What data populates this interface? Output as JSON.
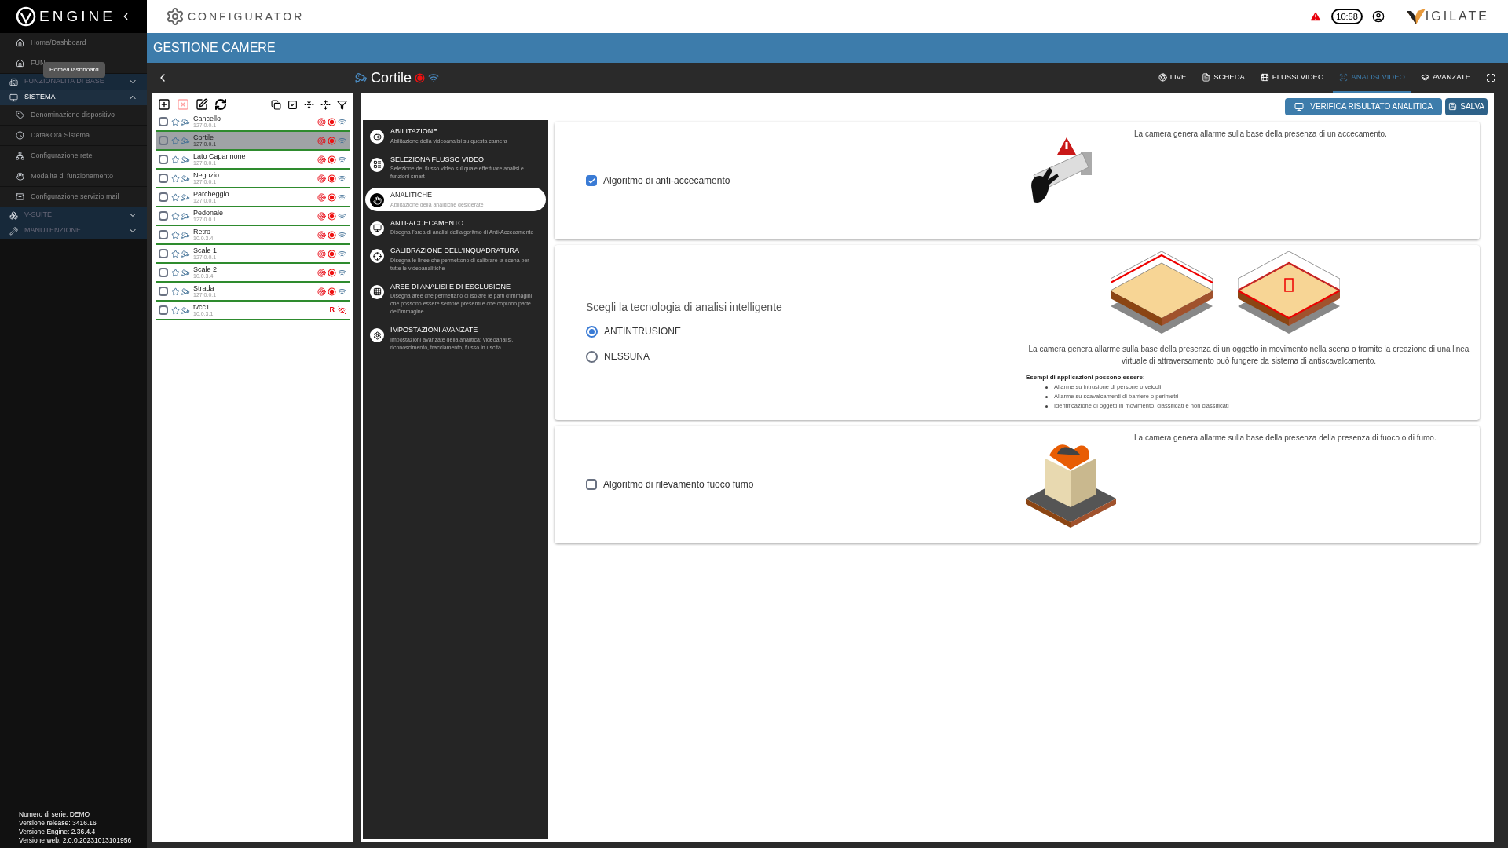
{
  "brand": {
    "name": "ENGINE",
    "app": "CONFIGURATOR",
    "vendor": "IGILATE"
  },
  "header": {
    "clock": "10:58",
    "alert": true
  },
  "sidebar": {
    "items": [
      {
        "kind": "item",
        "label": "Home/Dashboard"
      },
      {
        "kind": "item",
        "label": "FUN"
      },
      {
        "kind": "section",
        "label": "FUNZIONALITA DI BASE",
        "expanded": false
      },
      {
        "kind": "section",
        "label": "SISTEMA",
        "expanded": true,
        "children": [
          {
            "kind": "item",
            "label": "Denominazione dispositivo"
          },
          {
            "kind": "item",
            "label": "Data&Ora Sistema"
          },
          {
            "kind": "item",
            "label": "Configurazione rete"
          },
          {
            "kind": "item",
            "label": "Modalita di funzionamento"
          },
          {
            "kind": "item",
            "label": "Configurazione servizio mail"
          }
        ]
      },
      {
        "kind": "section",
        "label": "V-SUITE",
        "expanded": false
      },
      {
        "kind": "section",
        "label": "MANUTENZIONE",
        "expanded": false
      }
    ],
    "tooltip": "Home/Dashboard",
    "footer": [
      "Numero di serie: DEMO",
      "Versione release: 3416.16",
      "Versione Engine: 2.36.4.4",
      "Versione web: 2.0.0.20231013101956"
    ]
  },
  "page_title": "GESTIONE CAMERE",
  "camera": {
    "name": "Cortile",
    "online": true
  },
  "tabs": [
    {
      "label": "LIVE",
      "selected": false
    },
    {
      "label": "SCHEDA",
      "selected": false
    },
    {
      "label": "FLUSSI VIDEO",
      "selected": false
    },
    {
      "label": "ANALISI VIDEO",
      "selected": true
    },
    {
      "label": "AVANZATE",
      "selected": false
    }
  ],
  "cameras": [
    {
      "name": "Cancello",
      "ip": "127.0.0.1",
      "selected": false,
      "online": true
    },
    {
      "name": "Cortile",
      "ip": "127.0.0.1",
      "selected": true,
      "online": true
    },
    {
      "name": "Lato Capannone",
      "ip": "127.0.0.1",
      "selected": false,
      "online": true
    },
    {
      "name": "Negozio",
      "ip": "127.0.0.1",
      "selected": false,
      "online": true
    },
    {
      "name": "Parcheggio",
      "ip": "127.0.0.1",
      "selected": false,
      "online": true
    },
    {
      "name": "Pedonale",
      "ip": "127.0.0.1",
      "selected": false,
      "online": true
    },
    {
      "name": "Retro",
      "ip": "10.0.3.4",
      "selected": false,
      "online": true
    },
    {
      "name": "Scale 1",
      "ip": "127.0.0.1",
      "selected": false,
      "online": true
    },
    {
      "name": "Scale 2",
      "ip": "10.0.3.4",
      "selected": false,
      "online": true
    },
    {
      "name": "Strada",
      "ip": "127.0.0.1",
      "selected": false,
      "online": true
    },
    {
      "name": "tvcc1",
      "ip": "10.0.3.1",
      "selected": false,
      "online": false,
      "badge": "R"
    }
  ],
  "steps": [
    {
      "title": "ABILITAZIONE",
      "desc": "Abilitazione della videoanalisi su questa camera",
      "selected": false
    },
    {
      "title": "SELEZIONA FLUSSO VIDEO",
      "desc": "Selezione del flusso video sul quale effettuare analisi e funzioni smart",
      "selected": false
    },
    {
      "title": "ANALITICHE",
      "desc": "Abilitazione della analitiche desiderate",
      "selected": true
    },
    {
      "title": "ANTI-ACCECAMENTO",
      "desc": "Disegna l'area di analisi dell'algoritmo di Anti-Accecamento",
      "selected": false
    },
    {
      "title": "CALIBRAZIONE DELL'INQUADRATURA",
      "desc": "Disegna le linee che permettono di calibrare la scena per tutte le videoanalitiche",
      "selected": false
    },
    {
      "title": "AREE DI ANALISI E DI ESCLUSIONE",
      "desc": "Disegna aree che permettano di isolare le parti d'immagini che possono essere sempre presenti e che coprono parte dell'immagine",
      "selected": false
    },
    {
      "title": "IMPOSTAZIONI AVANZATE",
      "desc": "Impostazioni avanzate della analitica: videoanalisi, riconoscimento, tracciamento, flusso in uscita",
      "selected": false
    }
  ],
  "actions": [
    "VERIFICA RISULTATO ANALITICA",
    "SALVA"
  ],
  "cards": [
    {
      "kind": "checkbox",
      "label": "Algoritmo di anti-accecamento",
      "checked": true,
      "picture": {
        "kind": "blind"
      },
      "description": "La camera genera allarme sulla base della presenza di un accecamento."
    },
    {
      "kind": "radio",
      "heading": "Scegli la tecnologia di analisi intelligente",
      "options": [
        {
          "label": "ANTINTRUSIONE",
          "selected": true
        },
        {
          "label": "NESSUNA",
          "selected": false
        }
      ],
      "picture": {
        "kind": "intrusion"
      },
      "description": "La camera genera allarme sulla base della presenza di un oggetto in movimento nella scena o tramite la creazione di una linea virtuale di attraversamento può fungere da sistema di antiscavalcamento.",
      "examples_heading": "Esempi di applicazioni possono essere:",
      "examples": [
        "Allarme su intrusione di persone o veicoli",
        "Allarme su scavalcamenti di barriere o perimetri",
        "Identificazione di oggetti in movimento, classificati e non classificati"
      ]
    },
    {
      "kind": "checkbox",
      "label": "Algoritmo di rilevamento fuoco fumo",
      "checked": false,
      "picture": {
        "kind": "fire"
      },
      "description": "La camera genera allarme sulla base della presenza della presenza di fuoco o di fumo."
    }
  ]
}
